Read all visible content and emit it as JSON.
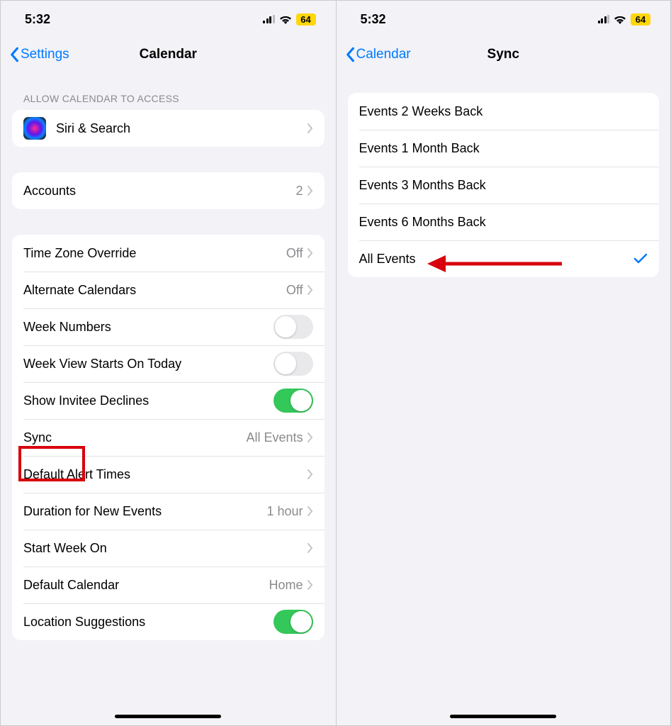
{
  "status": {
    "time": "5:32",
    "battery": "64"
  },
  "left": {
    "back": "Settings",
    "title": "Calendar",
    "allow_header": "ALLOW CALENDAR TO ACCESS",
    "siri": "Siri & Search",
    "accounts": {
      "label": "Accounts",
      "value": "2"
    },
    "rows": {
      "timezone": {
        "label": "Time Zone Override",
        "value": "Off"
      },
      "altcal": {
        "label": "Alternate Calendars",
        "value": "Off"
      },
      "weeknum": {
        "label": "Week Numbers"
      },
      "weekview": {
        "label": "Week View Starts On Today"
      },
      "invitee": {
        "label": "Show Invitee Declines"
      },
      "sync": {
        "label": "Sync",
        "value": "All Events"
      },
      "alert": {
        "label": "Default Alert Times"
      },
      "duration": {
        "label": "Duration for New Events",
        "value": "1 hour"
      },
      "startweek": {
        "label": "Start Week On"
      },
      "defaultcal": {
        "label": "Default Calendar",
        "value": "Home"
      },
      "location": {
        "label": "Location Suggestions"
      }
    }
  },
  "right": {
    "back": "Calendar",
    "title": "Sync",
    "options": [
      "Events 2 Weeks Back",
      "Events 1 Month Back",
      "Events 3 Months Back",
      "Events 6 Months Back",
      "All Events"
    ],
    "selected": 4
  }
}
